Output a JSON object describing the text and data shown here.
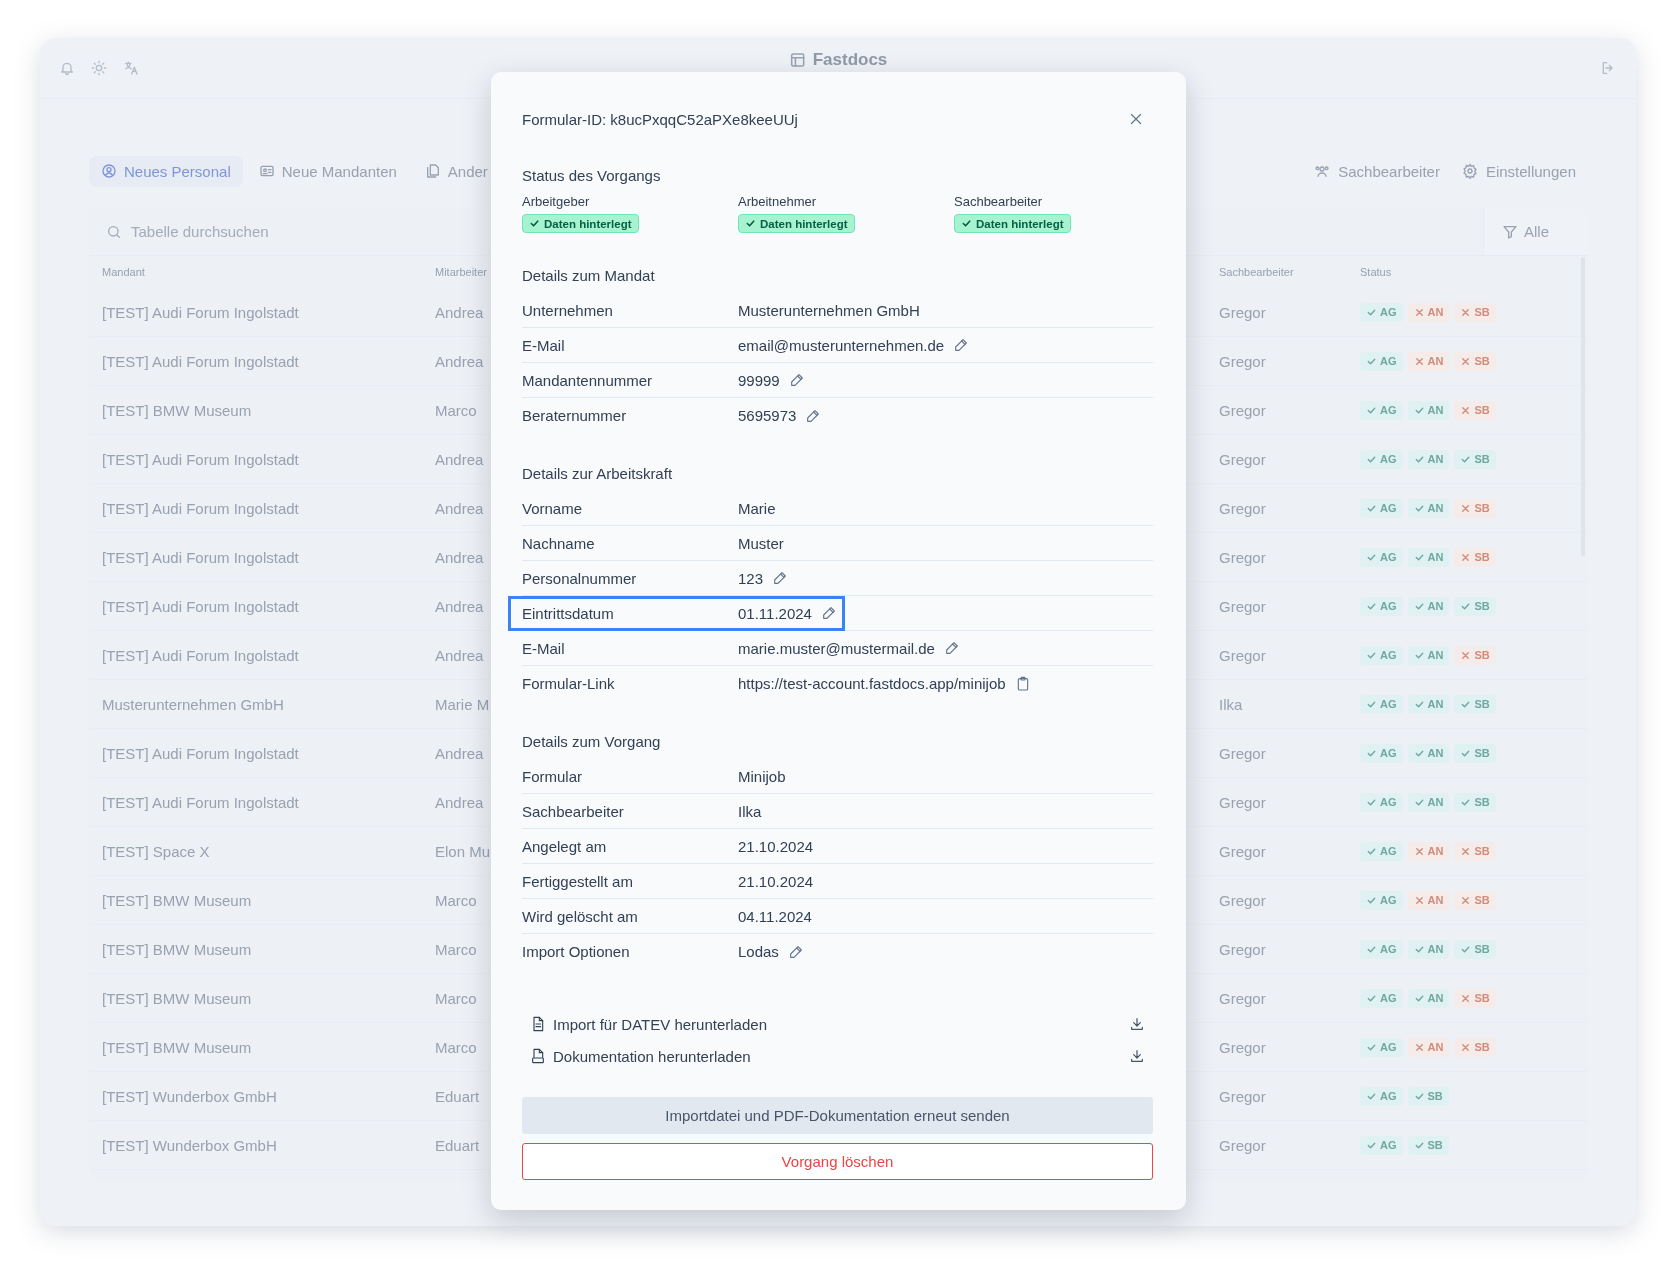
{
  "top_bar": {
    "title": "Fastdocs"
  },
  "nav_tabs": [
    {
      "label": "Neues Personal",
      "selected": true
    },
    {
      "label": "Neue Mandanten",
      "selected": false
    },
    {
      "label": "Ander",
      "selected": false
    }
  ],
  "nav_links": [
    {
      "label": "Sachbearbeiter"
    },
    {
      "label": "Einstellungen"
    }
  ],
  "table": {
    "search": {
      "placeholder": "Tabelle durchsuchen"
    },
    "filter": "Alle",
    "columns": [
      "Mandant",
      "Mitarbeiter",
      "Sachbearbeiter",
      "Status"
    ],
    "rows": [
      {
        "mandant": "[TEST] Audi Forum Ingolstadt",
        "mitarbeiter": "Andrea",
        "sachbearbeiter": "Gregor",
        "status": [
          {
            "label": "AG",
            "done": true
          },
          {
            "label": "AN",
            "done": false
          },
          {
            "label": "SB",
            "done": false
          }
        ]
      },
      {
        "mandant": "[TEST] Audi Forum Ingolstadt",
        "mitarbeiter": "Andrea",
        "sachbearbeiter": "Gregor",
        "status": [
          {
            "label": "AG",
            "done": true
          },
          {
            "label": "AN",
            "done": false
          },
          {
            "label": "SB",
            "done": false
          }
        ]
      },
      {
        "mandant": "[TEST] BMW Museum",
        "mitarbeiter": "Marco",
        "sachbearbeiter": "Gregor",
        "status": [
          {
            "label": "AG",
            "done": true
          },
          {
            "label": "AN",
            "done": true
          },
          {
            "label": "SB",
            "done": false
          }
        ]
      },
      {
        "mandant": "[TEST] Audi Forum Ingolstadt",
        "mitarbeiter": "Andrea",
        "sachbearbeiter": "Gregor",
        "status": [
          {
            "label": "AG",
            "done": true
          },
          {
            "label": "AN",
            "done": true
          },
          {
            "label": "SB",
            "done": true
          }
        ]
      },
      {
        "mandant": "[TEST] Audi Forum Ingolstadt",
        "mitarbeiter": "Andrea",
        "sachbearbeiter": "Gregor",
        "status": [
          {
            "label": "AG",
            "done": true
          },
          {
            "label": "AN",
            "done": true
          },
          {
            "label": "SB",
            "done": false
          }
        ]
      },
      {
        "mandant": "[TEST] Audi Forum Ingolstadt",
        "mitarbeiter": "Andrea",
        "sachbearbeiter": "Gregor",
        "status": [
          {
            "label": "AG",
            "done": true
          },
          {
            "label": "AN",
            "done": true
          },
          {
            "label": "SB",
            "done": false
          }
        ]
      },
      {
        "mandant": "[TEST] Audi Forum Ingolstadt",
        "mitarbeiter": "Andrea",
        "sachbearbeiter": "Gregor",
        "status": [
          {
            "label": "AG",
            "done": true
          },
          {
            "label": "AN",
            "done": true
          },
          {
            "label": "SB",
            "done": true
          }
        ]
      },
      {
        "mandant": "[TEST] Audi Forum Ingolstadt",
        "mitarbeiter": "Andrea",
        "sachbearbeiter": "Gregor",
        "status": [
          {
            "label": "AG",
            "done": true
          },
          {
            "label": "AN",
            "done": true
          },
          {
            "label": "SB",
            "done": false
          }
        ]
      },
      {
        "mandant": "Musterunternehmen GmbH",
        "mitarbeiter": "Marie M",
        "sachbearbeiter": "Ilka",
        "status": [
          {
            "label": "AG",
            "done": true
          },
          {
            "label": "AN",
            "done": true
          },
          {
            "label": "SB",
            "done": true
          }
        ]
      },
      {
        "mandant": "[TEST] Audi Forum Ingolstadt",
        "mitarbeiter": "Andrea",
        "sachbearbeiter": "Gregor",
        "status": [
          {
            "label": "AG",
            "done": true
          },
          {
            "label": "AN",
            "done": true
          },
          {
            "label": "SB",
            "done": true
          }
        ]
      },
      {
        "mandant": "[TEST] Audi Forum Ingolstadt",
        "mitarbeiter": "Andrea",
        "sachbearbeiter": "Gregor",
        "status": [
          {
            "label": "AG",
            "done": true
          },
          {
            "label": "AN",
            "done": true
          },
          {
            "label": "SB",
            "done": true
          }
        ]
      },
      {
        "mandant": "[TEST] Space X",
        "mitarbeiter": "Elon Mu",
        "sachbearbeiter": "Gregor",
        "status": [
          {
            "label": "AG",
            "done": true
          },
          {
            "label": "AN",
            "done": false
          },
          {
            "label": "SB",
            "done": false
          }
        ]
      },
      {
        "mandant": "[TEST] BMW Museum",
        "mitarbeiter": "Marco",
        "sachbearbeiter": "Gregor",
        "status": [
          {
            "label": "AG",
            "done": true
          },
          {
            "label": "AN",
            "done": false
          },
          {
            "label": "SB",
            "done": false
          }
        ]
      },
      {
        "mandant": "[TEST] BMW Museum",
        "mitarbeiter": "Marco",
        "sachbearbeiter": "Gregor",
        "status": [
          {
            "label": "AG",
            "done": true
          },
          {
            "label": "AN",
            "done": true
          },
          {
            "label": "SB",
            "done": true
          }
        ]
      },
      {
        "mandant": "[TEST] BMW Museum",
        "mitarbeiter": "Marco",
        "sachbearbeiter": "Gregor",
        "status": [
          {
            "label": "AG",
            "done": true
          },
          {
            "label": "AN",
            "done": true
          },
          {
            "label": "SB",
            "done": false
          }
        ]
      },
      {
        "mandant": "[TEST] BMW Museum",
        "mitarbeiter": "Marco",
        "sachbearbeiter": "Gregor",
        "status": [
          {
            "label": "AG",
            "done": true
          },
          {
            "label": "AN",
            "done": false
          },
          {
            "label": "SB",
            "done": false
          }
        ]
      },
      {
        "mandant": "[TEST] Wunderbox GmbH",
        "mitarbeiter": "Eduart",
        "sachbearbeiter": "Gregor",
        "status": [
          {
            "label": "AG",
            "done": true
          },
          {
            "label": "SB",
            "done": true
          }
        ]
      },
      {
        "mandant": "[TEST] Wunderbox GmbH",
        "mitarbeiter": "Eduart",
        "sachbearbeiter": "Gregor",
        "status": [
          {
            "label": "AG",
            "done": true
          },
          {
            "label": "SB",
            "done": true
          }
        ]
      }
    ]
  },
  "modal": {
    "title": "Formular-ID: k8ucPxqqC52aPXe8keeUUj",
    "status": {
      "heading": "Status des Vorgangs",
      "parties": [
        {
          "label": "Arbeitgeber",
          "badge": "Daten hinterlegt",
          "done": true
        },
        {
          "label": "Arbeitnehmer",
          "badge": "Daten hinterlegt",
          "done": true
        },
        {
          "label": "Sachbearbeiter",
          "badge": "Daten hinterlegt",
          "done": true
        }
      ]
    },
    "sections": [
      {
        "heading": "Details zum Mandat",
        "rows": [
          {
            "kind": "text",
            "label": "Unternehmen",
            "value": "Musterunternehmen GmbH",
            "highlighted": false
          },
          {
            "kind": "editable",
            "label": "E-Mail",
            "value": "email@musterunternehmen.de",
            "highlighted": false
          },
          {
            "kind": "editable",
            "label": "Mandantennummer",
            "value": "99999",
            "highlighted": false
          },
          {
            "kind": "editable",
            "label": "Beraternummer",
            "value": "5695973",
            "highlighted": false
          }
        ]
      },
      {
        "heading": "Details zur Arbeitskraft",
        "rows": [
          {
            "kind": "text",
            "label": "Vorname",
            "value": "Marie",
            "highlighted": false
          },
          {
            "kind": "text",
            "label": "Nachname",
            "value": "Muster",
            "highlighted": false
          },
          {
            "kind": "editable",
            "label": "Personalnummer",
            "value": "123",
            "highlighted": false
          },
          {
            "kind": "editable",
            "label": "Eintrittsdatum",
            "value": "01.11.2024",
            "highlighted": true
          },
          {
            "kind": "editable",
            "label": "E-Mail",
            "value": "marie.muster@mustermail.de",
            "highlighted": false
          },
          {
            "kind": "copyable",
            "label": "Formular-Link",
            "value": "https://test-account.fastdocs.app/minijob",
            "highlighted": false
          }
        ]
      },
      {
        "heading": "Details zum Vorgang",
        "rows": [
          {
            "kind": "text",
            "label": "Formular",
            "value": "Minijob",
            "highlighted": false
          },
          {
            "kind": "text",
            "label": "Sachbearbeiter",
            "value": "Ilka",
            "highlighted": false
          },
          {
            "kind": "text",
            "label": "Angelegt am",
            "value": "21.10.2024",
            "highlighted": false
          },
          {
            "kind": "text",
            "label": "Fertiggestellt am",
            "value": "21.10.2024",
            "highlighted": false
          },
          {
            "kind": "text",
            "label": "Wird gelöscht am",
            "value": "04.11.2024",
            "highlighted": false
          },
          {
            "kind": "editable",
            "label": "Import Optionen",
            "value": "Lodas",
            "highlighted": false
          }
        ]
      }
    ],
    "downloads": [
      {
        "kind": "file",
        "label": "Import für DATEV herunterladen"
      },
      {
        "kind": "pdf",
        "label": "Dokumentation herunterladen"
      }
    ],
    "buttons": [
      {
        "kind": "secondary",
        "label": "Importdatei und PDF-Dokumentation erneut senden"
      },
      {
        "kind": "danger",
        "label": "Vorgang löschen"
      }
    ]
  }
}
